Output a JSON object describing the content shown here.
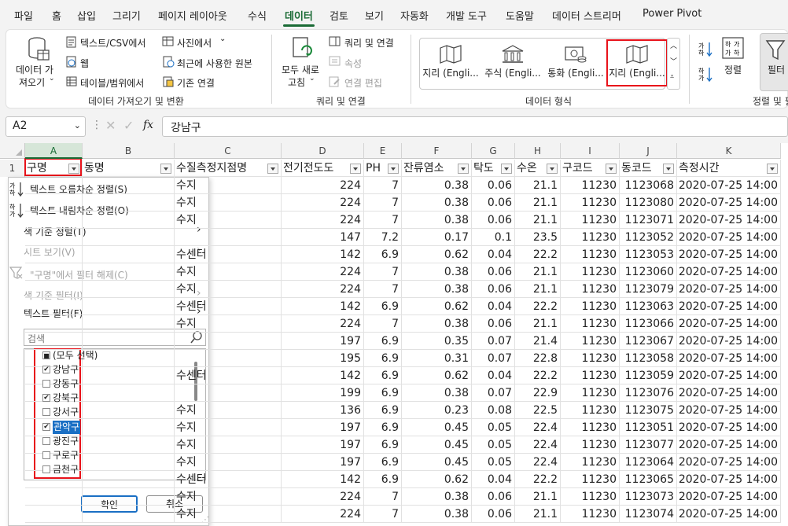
{
  "menu": {
    "tabs": [
      {
        "label": "파일"
      },
      {
        "label": "홈"
      },
      {
        "label": "삽입"
      },
      {
        "label": "그리기"
      },
      {
        "label": "페이지 레이아웃"
      },
      {
        "label": "수식"
      },
      {
        "label": "데이터"
      },
      {
        "label": "검토"
      },
      {
        "label": "보기"
      },
      {
        "label": "자동화"
      },
      {
        "label": "개발 도구"
      },
      {
        "label": "도움말"
      },
      {
        "label": "데이터 스트리머"
      },
      {
        "label": "Power Pivot"
      }
    ],
    "active": "데이터"
  },
  "ribbon": {
    "get_data": {
      "line1": "데이터 가",
      "line2": "져오기"
    },
    "from_text_csv": "텍스트/CSV에서",
    "web": "웹",
    "from_table": "테이블/범위에서",
    "from_picture": "사진에서",
    "recent_sources": "최근에 사용한 원본",
    "existing_connections": "기존 연결",
    "group_get_transform": "데이터 가져오기 및 변환",
    "refresh_all": {
      "line1": "모두 새로",
      "line2": "고침"
    },
    "queries_connections": "쿼리 및 연결",
    "properties": "속성",
    "edit_links": "연결 편집",
    "group_queries": "쿼리 및 연결",
    "data_types": [
      {
        "label": "지리 (Engli...",
        "icon": "map-icon"
      },
      {
        "label": "주식 (Engli...",
        "icon": "bank-icon"
      },
      {
        "label": "통화 (Engli...",
        "icon": "currency-icon"
      },
      {
        "label": "지리 (Engli...",
        "icon": "map-icon"
      }
    ],
    "group_data_types": "데이터 형식",
    "sort": "정렬",
    "filter": "필터",
    "group_sort_filter": "정렬 및 필"
  },
  "formula_bar": {
    "name_box": "A2",
    "content": "강남구",
    "fx": "fx"
  },
  "columns": [
    "A",
    "B",
    "C",
    "D",
    "E",
    "F",
    "G",
    "H",
    "I",
    "J",
    "K"
  ],
  "header_row": [
    "구명",
    "동명",
    "수질측정지점명",
    "전기전도도",
    "PH",
    "잔류염소",
    "탁도",
    "수온",
    "구코드",
    "동코드",
    "측정시간"
  ],
  "row_numbers": [
    "1"
  ],
  "rows": [
    {
      "c": "수지",
      "d": "224",
      "e": "7",
      "f": "0.38",
      "g": "0.06",
      "h": "21.1",
      "i": "11230",
      "j": "1123068",
      "k": "2020-07-25 14:00"
    },
    {
      "c": "수지",
      "d": "224",
      "e": "7",
      "f": "0.38",
      "g": "0.06",
      "h": "21.1",
      "i": "11230",
      "j": "1123080",
      "k": "2020-07-25 14:00"
    },
    {
      "c": "수지",
      "d": "224",
      "e": "7",
      "f": "0.38",
      "g": "0.06",
      "h": "21.1",
      "i": "11230",
      "j": "1123071",
      "k": "2020-07-25 14:00"
    },
    {
      "c": "",
      "d": "147",
      "e": "7.2",
      "f": "0.17",
      "g": "0.1",
      "h": "23.5",
      "i": "11230",
      "j": "1123052",
      "k": "2020-07-25 14:00"
    },
    {
      "c": "수센터",
      "d": "142",
      "e": "6.9",
      "f": "0.62",
      "g": "0.04",
      "h": "22.2",
      "i": "11230",
      "j": "1123053",
      "k": "2020-07-25 14:00"
    },
    {
      "c": "수지",
      "d": "224",
      "e": "7",
      "f": "0.38",
      "g": "0.06",
      "h": "21.1",
      "i": "11230",
      "j": "1123060",
      "k": "2020-07-25 14:00"
    },
    {
      "c": "수지",
      "d": "224",
      "e": "7",
      "f": "0.38",
      "g": "0.06",
      "h": "21.1",
      "i": "11230",
      "j": "1123079",
      "k": "2020-07-25 14:00"
    },
    {
      "c": "수센터",
      "d": "142",
      "e": "6.9",
      "f": "0.62",
      "g": "0.04",
      "h": "22.2",
      "i": "11230",
      "j": "1123063",
      "k": "2020-07-25 14:00"
    },
    {
      "c": "수지",
      "d": "224",
      "e": "7",
      "f": "0.38",
      "g": "0.06",
      "h": "21.1",
      "i": "11230",
      "j": "1123066",
      "k": "2020-07-25 14:00"
    },
    {
      "c": "",
      "d": "197",
      "e": "6.9",
      "f": "0.35",
      "g": "0.07",
      "h": "21.4",
      "i": "11230",
      "j": "1123067",
      "k": "2020-07-25 14:00"
    },
    {
      "c": "",
      "d": "195",
      "e": "6.9",
      "f": "0.31",
      "g": "0.07",
      "h": "22.8",
      "i": "11230",
      "j": "1123058",
      "k": "2020-07-25 14:00"
    },
    {
      "c": "수센터",
      "d": "142",
      "e": "6.9",
      "f": "0.62",
      "g": "0.04",
      "h": "22.2",
      "i": "11230",
      "j": "1123059",
      "k": "2020-07-25 14:00"
    },
    {
      "c": "",
      "d": "199",
      "e": "6.9",
      "f": "0.38",
      "g": "0.07",
      "h": "22.9",
      "i": "11230",
      "j": "1123076",
      "k": "2020-07-25 14:00"
    },
    {
      "c": "수지",
      "d": "136",
      "e": "6.9",
      "f": "0.23",
      "g": "0.08",
      "h": "22.5",
      "i": "11230",
      "j": "1123075",
      "k": "2020-07-25 14:00"
    },
    {
      "c": "수지",
      "d": "197",
      "e": "6.9",
      "f": "0.45",
      "g": "0.05",
      "h": "22.4",
      "i": "11230",
      "j": "1123051",
      "k": "2020-07-25 14:00"
    },
    {
      "c": "수지",
      "d": "197",
      "e": "6.9",
      "f": "0.45",
      "g": "0.05",
      "h": "22.4",
      "i": "11230",
      "j": "1123077",
      "k": "2020-07-25 14:00"
    },
    {
      "c": "수지",
      "d": "197",
      "e": "6.9",
      "f": "0.45",
      "g": "0.05",
      "h": "22.4",
      "i": "11230",
      "j": "1123064",
      "k": "2020-07-25 14:00"
    },
    {
      "c": "수센터",
      "d": "142",
      "e": "6.9",
      "f": "0.62",
      "g": "0.04",
      "h": "22.2",
      "i": "11230",
      "j": "1123065",
      "k": "2020-07-25 14:00"
    },
    {
      "c": "수지",
      "d": "224",
      "e": "7",
      "f": "0.38",
      "g": "0.06",
      "h": "21.1",
      "i": "11230",
      "j": "1123073",
      "k": "2020-07-25 14:00"
    },
    {
      "c": "수지",
      "d": "224",
      "e": "7",
      "f": "0.38",
      "g": "0.06",
      "h": "21.1",
      "i": "11230",
      "j": "1123074",
      "k": "2020-07-25 14:00"
    }
  ],
  "filter_menu": {
    "sort_asc": "텍스트 오름차순 정렬(S)",
    "sort_desc": "텍스트 내림차순 정렬(O)",
    "sort_by_color": "색 기준 정렬(T)",
    "sheet_view": "시트 보기(V)",
    "clear_filter": "\"구명\"에서 필터 해제(C)",
    "filter_by_color": "색 기준 필터(I)",
    "text_filters": "텍스트 필터(F)",
    "search_placeholder": "검색",
    "items": [
      {
        "label": "(모두 선택)",
        "state": "partial"
      },
      {
        "label": "강남구",
        "state": "checked"
      },
      {
        "label": "강동구",
        "state": "unchecked"
      },
      {
        "label": "강북구",
        "state": "checked"
      },
      {
        "label": "강서구",
        "state": "unchecked"
      },
      {
        "label": "관악구",
        "state": "checked",
        "selected": true
      },
      {
        "label": "광진구",
        "state": "unchecked"
      },
      {
        "label": "구로구",
        "state": "unchecked"
      },
      {
        "label": "금천구",
        "state": "unchecked"
      }
    ],
    "ok": "확인",
    "cancel": "취소"
  },
  "colors": {
    "accent_green": "#1a6b35",
    "highlight_red": "#e8121a",
    "selection_blue": "#1a6fc4"
  }
}
